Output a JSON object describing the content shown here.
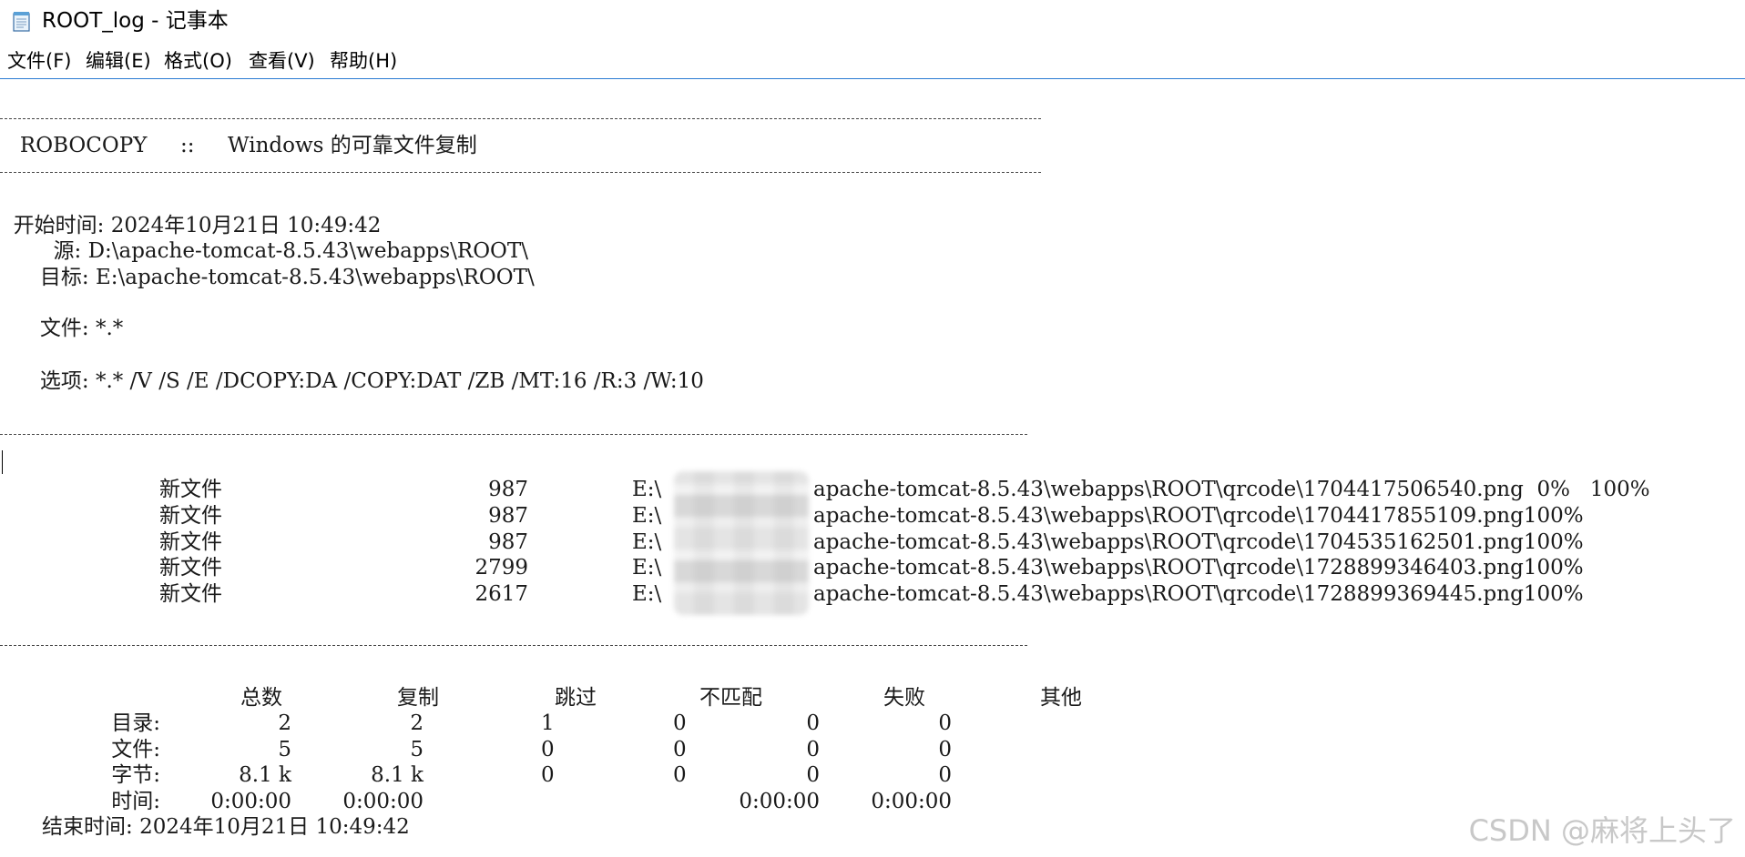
{
  "window": {
    "title": "ROOT_log - 记事本"
  },
  "menu": [
    "文件(F)",
    "编辑(E)",
    "格式(O)",
    "查看(V)",
    "帮助(H)"
  ],
  "header": {
    "rule": "-------------------------------------------------------------------------------",
    "banner": "   ROBOCOPY     ::     Windows 的可靠文件复制",
    "start_label": "  开始时间: ",
    "start_time": "2024年10月21日 10:49:42",
    "source_label": "        源: ",
    "source": "D:\\apache-tomcat-8.5.43\\webapps\\ROOT\\",
    "dest_label": "      目标: ",
    "dest": "E:\\apache-tomcat-8.5.43\\webapps\\ROOT\\",
    "files_label": "      文件: ",
    "files": "*.*",
    "options_label": "      选项: ",
    "options": "*.* /V /S /E /DCOPY:DA /COPY:DAT /ZB /MT:16 /R:3 /W:10"
  },
  "section_rule": "------------------------------------------------------------------------------",
  "entries": [
    {
      "status": "新文件",
      "size": "987",
      "drive": "E:\\",
      "path": "apache-tomcat-8.5.43\\webapps\\ROOT\\qrcode\\1704417506540.png",
      "progress": "  0%   100%"
    },
    {
      "status": "新文件",
      "size": "987",
      "drive": "E:\\",
      "path": "apache-tomcat-8.5.43\\webapps\\ROOT\\qrcode\\1704417855109.png",
      "progress": "100%"
    },
    {
      "status": "新文件",
      "size": "987",
      "drive": "E:\\",
      "path": "apache-tomcat-8.5.43\\webapps\\ROOT\\qrcode\\1704535162501.png",
      "progress": "100%"
    },
    {
      "status": "新文件",
      "size": "2799",
      "drive": "E:\\",
      "path": "apache-tomcat-8.5.43\\webapps\\ROOT\\qrcode\\1728899346403.png",
      "progress": "100%"
    },
    {
      "status": "新文件",
      "size": "2617",
      "drive": "E:\\",
      "path": "apache-tomcat-8.5.43\\webapps\\ROOT\\qrcode\\1728899369445.png",
      "progress": "100%"
    }
  ],
  "summary": {
    "headers": [
      "总数",
      "复制",
      "跳过",
      "不匹配",
      "失败",
      "其他"
    ],
    "rows": [
      {
        "label": "目录:",
        "values": [
          "2",
          "2",
          "1",
          "0",
          "0",
          "0"
        ]
      },
      {
        "label": "文件:",
        "values": [
          "5",
          "5",
          "0",
          "0",
          "0",
          "0"
        ]
      },
      {
        "label": "字节:",
        "values": [
          "8.1 k",
          "8.1 k",
          "0",
          "0",
          "0",
          "0"
        ]
      },
      {
        "label": "时间:",
        "values": [
          "0:00:00",
          "0:00:00",
          "",
          "",
          "0:00:00",
          "0:00:00"
        ]
      }
    ],
    "end_label": "结束时间: ",
    "end_time": "2024年10月21日 10:49:42"
  },
  "watermark": "CSDN @麻将上头了",
  "colors": {
    "menu_separator": "#2b7bd3",
    "background": "#ffffff"
  },
  "icons": {
    "app": "notepad-icon"
  }
}
